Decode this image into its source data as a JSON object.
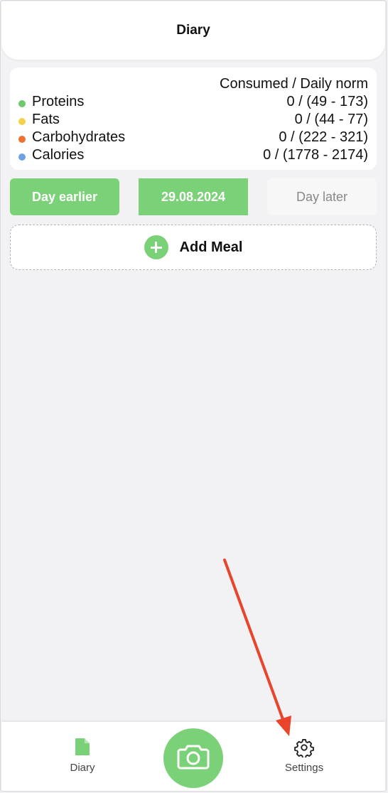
{
  "header": {
    "title": "Diary"
  },
  "summary": {
    "column_header": "Consumed / Daily norm",
    "rows": [
      {
        "label": "Proteins",
        "value": "0 / (49 - 173)",
        "color": "#6cc96c"
      },
      {
        "label": "Fats",
        "value": "0 / (44 - 77)",
        "color": "#f2d24b"
      },
      {
        "label": "Carbohydrates",
        "value": "0 / (222 - 321)",
        "color": "#f0712d"
      },
      {
        "label": "Calories",
        "value": "0 / (1778 - 2174)",
        "color": "#6ea0e6"
      }
    ]
  },
  "day_nav": {
    "earlier": "Day earlier",
    "date": "29.08.2024",
    "later": "Day later"
  },
  "add_meal": {
    "label": "Add Meal",
    "icon": "plus-circle-icon"
  },
  "tabbar": {
    "diary": {
      "label": "Diary",
      "icon": "document-icon"
    },
    "camera": {
      "icon": "camera-icon"
    },
    "settings": {
      "label": "Settings",
      "icon": "gear-icon"
    }
  },
  "colors": {
    "accent": "#7ad178",
    "annotation_arrow": "#e8452c",
    "background": "#f2f2f4"
  }
}
